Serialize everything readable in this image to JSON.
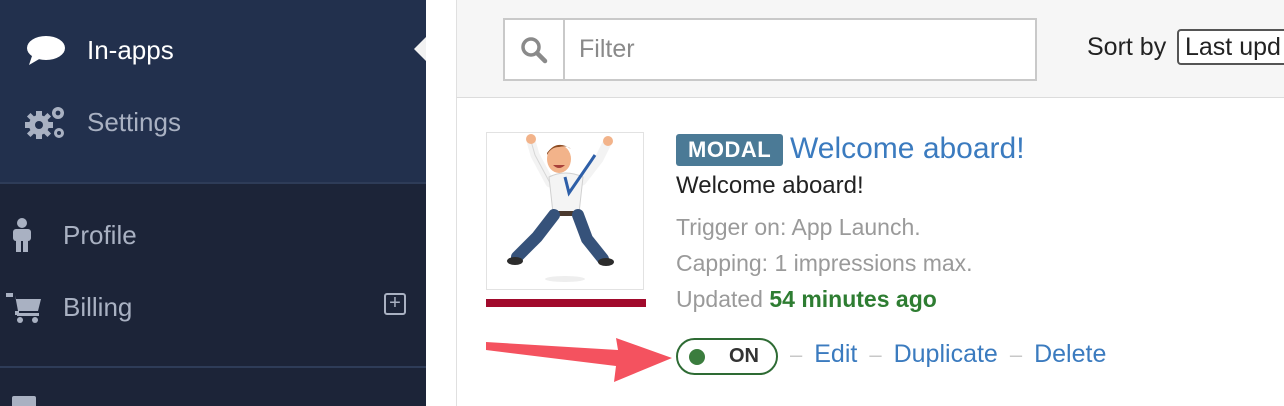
{
  "sidebar": {
    "items": [
      {
        "label": "In-apps",
        "icon": "speech-bubble-icon"
      },
      {
        "label": "Settings",
        "icon": "gears-icon"
      },
      {
        "label": "Profile",
        "icon": "person-icon"
      },
      {
        "label": "Billing",
        "icon": "cart-icon"
      }
    ],
    "billing_add_icon": "plus-square-icon"
  },
  "toolbar": {
    "search_placeholder": "Filter",
    "sort_label": "Sort by",
    "sort_value": "Last upd"
  },
  "campaign": {
    "badge": "MODAL",
    "title": "Welcome aboard!",
    "message": "Welcome aboard!",
    "trigger": "Trigger on: App Launch.",
    "capping": "Capping: 1 impressions max.",
    "updated_label": "Updated",
    "updated_value": "54 minutes ago",
    "status": "ON",
    "actions": {
      "edit": "Edit",
      "duplicate": "Duplicate",
      "delete": "Delete"
    }
  },
  "colors": {
    "sidebar_bg": "#1c2438",
    "sidebar_active_bg": "#22304d",
    "link": "#3b7bbf",
    "badge": "#4b7a96",
    "status_on": "#2e6b34",
    "thumb_bar": "#a10a2c",
    "annotation_arrow": "#f4525f"
  }
}
